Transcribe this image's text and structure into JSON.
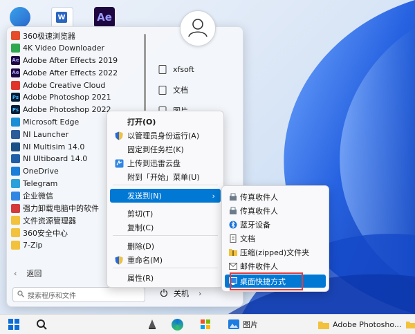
{
  "start_menu": {
    "apps": [
      {
        "label": "360极速浏览器",
        "icon": "360-browser-icon",
        "color": "#e44c2a"
      },
      {
        "label": "4K Video Downloader",
        "icon": "4k-downloader-icon",
        "color": "#2fa84f"
      },
      {
        "label": "Adobe After Effects 2019",
        "icon": "after-effects-icon",
        "color": "#1f0740",
        "glyph": "Ae"
      },
      {
        "label": "Adobe After Effects 2022",
        "icon": "after-effects-icon",
        "color": "#1f0740",
        "glyph": "Ae"
      },
      {
        "label": "Adobe Creative Cloud",
        "icon": "creative-cloud-icon",
        "color": "#e0342a"
      },
      {
        "label": "Adobe Photoshop 2021",
        "icon": "photoshop-icon",
        "color": "#061e36",
        "glyph": "Ps"
      },
      {
        "label": "Adobe Photoshop 2022",
        "icon": "photoshop-icon",
        "color": "#061e36",
        "glyph": "Ps"
      },
      {
        "label": "Microsoft Edge",
        "icon": "edge-icon",
        "color": "#1b8fd6"
      },
      {
        "label": "NI Launcher",
        "icon": "ni-icon",
        "color": "#2b5d9b"
      },
      {
        "label": "NI Multisim 14.0",
        "icon": "multisim-icon",
        "color": "#1b4f86"
      },
      {
        "label": "NI Ultiboard 14.0",
        "icon": "ultiboard-icon",
        "color": "#1f5fa8"
      },
      {
        "label": "OneDrive",
        "icon": "onedrive-icon",
        "color": "#1a7fd9"
      },
      {
        "label": "Telegram",
        "icon": "telegram-icon",
        "color": "#2aa1da"
      },
      {
        "label": "企业微信",
        "icon": "wecom-icon",
        "color": "#2f86e3"
      },
      {
        "label": "强力卸载电脑中的软件",
        "icon": "uninstall-icon",
        "color": "#d43a3a"
      },
      {
        "label": "文件资源管理器",
        "icon": "folder-icon",
        "color": "#f2c23c"
      },
      {
        "label": "360安全中心",
        "icon": "folder-icon",
        "color": "#f2c23c"
      },
      {
        "label": "7-Zip",
        "icon": "folder-icon",
        "color": "#f2c23c"
      }
    ],
    "back_label": "返回",
    "search_placeholder": "搜索程序和文件",
    "right_items": [
      {
        "label": "xfsoft",
        "icon": "user-folder-icon"
      },
      {
        "label": "文档",
        "icon": "document-icon"
      },
      {
        "label": "图片",
        "icon": "picture-icon"
      }
    ],
    "power_label": "关机"
  },
  "context_menu": {
    "items": [
      {
        "label": "打开(O)",
        "bold": true,
        "icon": ""
      },
      {
        "label": "以管理员身份运行(A)",
        "icon": "shield-icon"
      },
      {
        "label": "固定到任务栏(K)",
        "icon": ""
      },
      {
        "label": "上传到迅雷云盘",
        "icon": "xunlei-icon"
      },
      {
        "label": "附到「开始」菜单(U)",
        "icon": ""
      },
      {
        "label": "发送到(N)",
        "icon": "",
        "highlighted": true,
        "has_submenu": true
      },
      {
        "label": "剪切(T)",
        "icon": ""
      },
      {
        "label": "复制(C)",
        "icon": ""
      },
      {
        "label": "删除(D)",
        "icon": ""
      },
      {
        "label": "重命名(M)",
        "icon": "shield-icon"
      },
      {
        "label": "属性(R)",
        "icon": ""
      }
    ]
  },
  "send_to_menu": {
    "items": [
      {
        "label": "传真收件人",
        "icon": "fax-icon"
      },
      {
        "label": "传真收件人",
        "icon": "fax-icon"
      },
      {
        "label": "蓝牙设备",
        "icon": "bluetooth-icon"
      },
      {
        "label": "文档",
        "icon": "document-icon"
      },
      {
        "label": "压缩(zipped)文件夹",
        "icon": "zip-folder-icon"
      },
      {
        "label": "邮件收件人",
        "icon": "mail-icon"
      },
      {
        "label": "桌面快捷方式",
        "icon": "desktop-icon",
        "highlighted": true
      }
    ]
  },
  "taskbar": {
    "pictures_label": "图片",
    "folder_label": "Adobe Photosho..."
  },
  "desktop": {
    "ae_label": "Ae"
  }
}
